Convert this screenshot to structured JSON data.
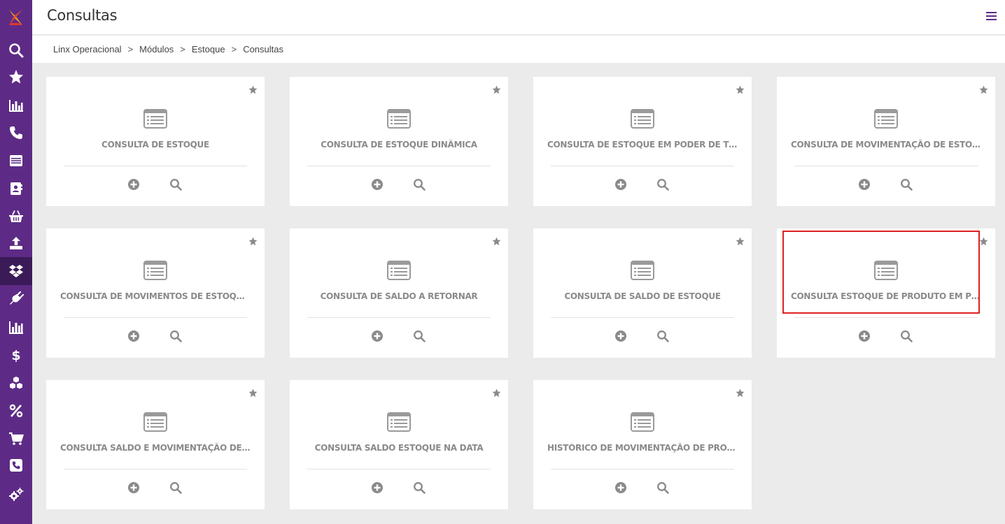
{
  "app": {
    "brand_color": "#5d2b86",
    "logo_icon": "linx-logo"
  },
  "header": {
    "title": "Consultas",
    "menu_icon": "hamburger-menu-icon"
  },
  "breadcrumb": [
    "Linx Operacional",
    "Módulos",
    "Estoque",
    "Consultas"
  ],
  "breadcrumb_separator": ">",
  "sidebar": {
    "items": [
      {
        "icon": "search-icon"
      },
      {
        "icon": "star-icon"
      },
      {
        "icon": "bar-chart-icon"
      },
      {
        "icon": "phone-icon"
      },
      {
        "icon": "list-card-icon"
      },
      {
        "icon": "contacts-book-icon"
      },
      {
        "icon": "basket-icon"
      },
      {
        "icon": "upload-icon"
      },
      {
        "icon": "dropbox-icon",
        "active": true
      },
      {
        "icon": "plug-icon"
      },
      {
        "icon": "reports-chart-icon"
      },
      {
        "icon": "dollar-icon"
      },
      {
        "icon": "boxes-icon"
      },
      {
        "icon": "percent-icon"
      },
      {
        "icon": "cart-icon"
      },
      {
        "icon": "phone-square-icon"
      },
      {
        "icon": "gears-icon"
      }
    ]
  },
  "cards": [
    {
      "title": "CONSULTA DE ESTOQUE"
    },
    {
      "title": "CONSULTA DE ESTOQUE DINÂMICA"
    },
    {
      "title": "CONSULTA DE ESTOQUE EM PODER DE TERC..."
    },
    {
      "title": "CONSULTA DE MOVIMENTAÇÃO DE ESTOQUE ..."
    },
    {
      "title": "CONSULTA DE MOVIMENTOS DE ESTOQUE DE ..."
    },
    {
      "title": "CONSULTA DE SALDO A RETORNAR"
    },
    {
      "title": "CONSULTA DE SALDO DE ESTOQUE"
    },
    {
      "title": "CONSULTA ESTOQUE DE PRODUTO EM PODE...",
      "highlighted": true
    },
    {
      "title": "CONSULTA SALDO E MOVIMENTAÇÃO DE EST..."
    },
    {
      "title": "CONSULTA SALDO ESTOQUE NA DATA"
    },
    {
      "title": "HISTÓRICO DE MOVIMENTAÇÃO DE PRODUTO"
    }
  ],
  "card_icons": {
    "main": "list-window-icon",
    "favorite": "star-icon",
    "add": "plus-circle-icon",
    "search": "search-icon"
  },
  "highlight_color": "#e02020"
}
